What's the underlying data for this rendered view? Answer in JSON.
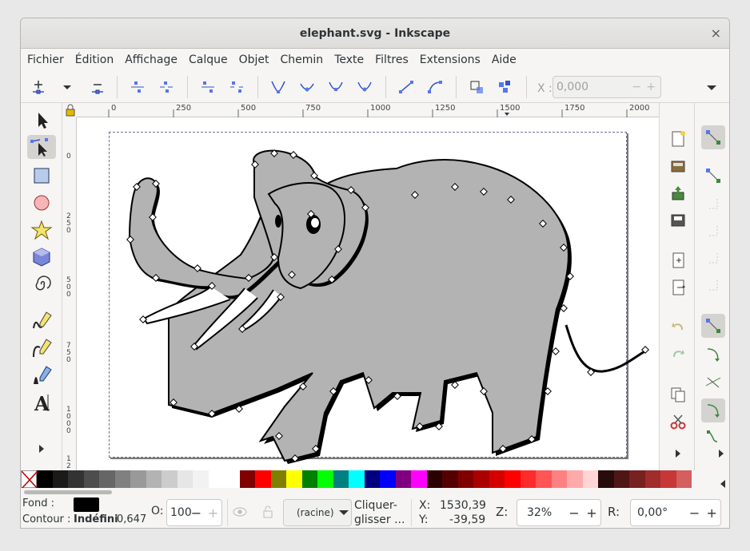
{
  "window": {
    "title": "elephant.svg - Inkscape",
    "close_glyph": "×"
  },
  "menu": [
    "Fichier",
    "Édition",
    "Affichage",
    "Calque",
    "Objet",
    "Chemin",
    "Texte",
    "Filtres",
    "Extensions",
    "Aide"
  ],
  "node_toolbar": {
    "x_label": "X :",
    "x_value": "0,000",
    "minus": "−",
    "plus": "+",
    "overflow_icon": "chevron-down-icon"
  },
  "ruler": {
    "top_ticks": [
      "0",
      "250",
      "500",
      "750",
      "1000",
      "1250",
      "1500",
      "1750",
      "2000"
    ],
    "left_ticks": [
      "0",
      "2 5 0",
      "5 0 0",
      "7 5 0",
      "1 0 0 0",
      "1 2"
    ]
  },
  "tools": [
    "selector-tool",
    "node-tool",
    "rectangle-tool",
    "ellipse-tool",
    "star-tool",
    "3d-box-tool",
    "spiral-tool",
    "pencil-tool",
    "pen-tool",
    "calligraphy-tool",
    "text-tool"
  ],
  "palette": {
    "none_swatch": "none",
    "colors": [
      "#000000",
      "#1a1a1a",
      "#333333",
      "#4d4d4d",
      "#666666",
      "#808080",
      "#999999",
      "#b3b3b3",
      "#cccccc",
      "#e6e6e6",
      "#f2f2f2",
      "#ffffff",
      "#ffffff",
      "#800000",
      "#ff0000",
      "#808000",
      "#ffff00",
      "#008000",
      "#00ff00",
      "#008080",
      "#00ffff",
      "#000080",
      "#0000ff",
      "#800080",
      "#ff00ff",
      "#2b0000",
      "#550000",
      "#800000",
      "#aa0000",
      "#d40000",
      "#ff0000",
      "#ff2a2a",
      "#ff5555",
      "#ff8080",
      "#ffaaaa",
      "#ffd5d5",
      "#280b0b",
      "#501616",
      "#782121",
      "#a02c2c",
      "#c83737",
      "#d35f5f"
    ]
  },
  "status": {
    "fill_label": "Fond :",
    "fill_color": "#000000",
    "stroke_label": "Contour :",
    "stroke_value": "Indéfini",
    "stroke_width": "0,647",
    "opacity_label": "O:",
    "opacity_value": "100",
    "layer_value": "(racine)",
    "message_line1": "Cliquer-",
    "message_line2": "glisser ...",
    "x_label": "X:",
    "x_value": "1530,39",
    "y_label": "Y:",
    "y_value": "-39,59",
    "zoom_label": "Z:",
    "zoom_value": "32%",
    "rotate_label": "R:",
    "rotate_value": "0,00°",
    "minus": "−",
    "plus": "+"
  },
  "colors": {
    "elephant_fill": "#b3b3b3",
    "elephant_stroke": "#000000",
    "page_border": "#6f7190",
    "node_handle": "#ffffff"
  }
}
